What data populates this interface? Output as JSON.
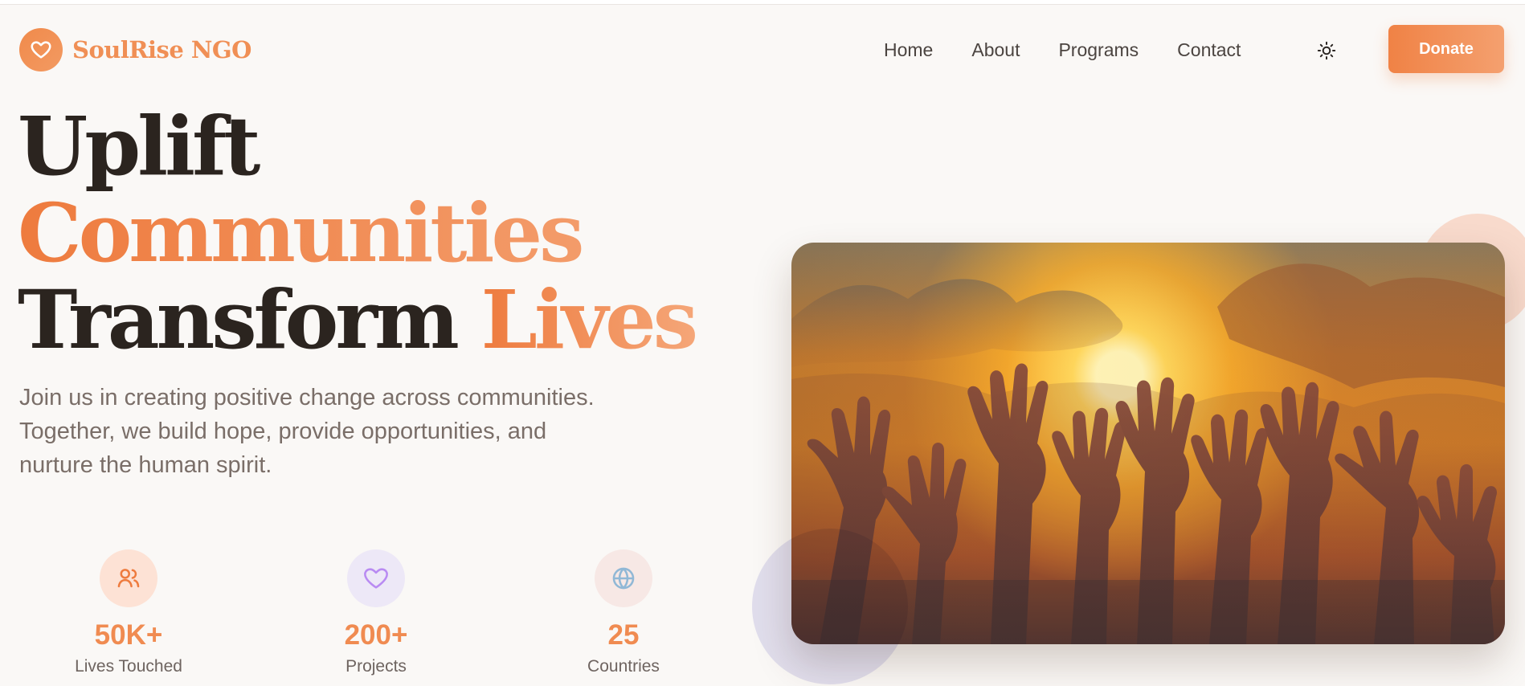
{
  "brand": {
    "name": "SoulRise NGO",
    "logo_icon": "heart-icon",
    "accent_color": "#f08a4b"
  },
  "nav": {
    "items": [
      "Home",
      "About",
      "Programs",
      "Contact"
    ],
    "theme_icon": "sun-icon",
    "donate_label": "Donate"
  },
  "hero": {
    "title_line1": "Uplift",
    "title_line2": "Communities",
    "title_line3_part1": "Transform",
    "title_line3_part2": "Lives",
    "subtitle": "Join us in creating positive change across communities. Together, we build hope, provide opportunities, and nurture the human spirit.",
    "image_icon": "raised-hands-sunset-image"
  },
  "stats": [
    {
      "value": "50K+",
      "label": "Lives Touched",
      "icon": "users-icon",
      "bg_color": "#fde2d5",
      "icon_color": "#ee7b3e"
    },
    {
      "value": "200+",
      "label": "Projects",
      "icon": "heart-icon",
      "bg_color": "#ede8f7",
      "icon_color": "#b98bf2"
    },
    {
      "value": "25",
      "label": "Countries",
      "icon": "globe-icon",
      "bg_color": "#f7e8e5",
      "icon_color": "#91b8d6"
    }
  ]
}
